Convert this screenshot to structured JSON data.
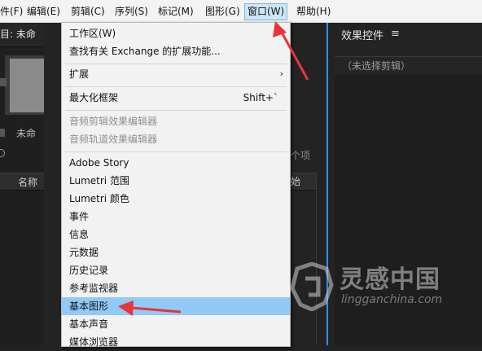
{
  "menubar": {
    "items": [
      {
        "label": "件(F)"
      },
      {
        "label": "编辑(E)"
      },
      {
        "label": "剪辑(C)"
      },
      {
        "label": "序列(S)"
      },
      {
        "label": "标记(M)"
      },
      {
        "label": "图形(G)"
      },
      {
        "label": "窗口(W)",
        "active": true
      },
      {
        "label": "帮助(H)"
      }
    ]
  },
  "left_panel": {
    "header": "目: 未命",
    "name_text": "未命",
    "column_name": "名称"
  },
  "middle_strip": {
    "count_text": "个项",
    "column_start": "始"
  },
  "effect_controls": {
    "title": "效果控件",
    "menu_icon": "hamburger-icon",
    "no_clip": "（未选择剪辑）"
  },
  "window_menu": {
    "items": [
      {
        "label": "工作区(W)",
        "submenu": false
      },
      {
        "label": "查找有关 Exchange 的扩展功能...",
        "submenu": false
      },
      {
        "label": "扩展",
        "submenu": true
      },
      {
        "label": "最大化框架",
        "shortcut": "Shift+`"
      },
      {
        "label": "音频剪辑效果编辑器",
        "disabled": true
      },
      {
        "label": "音频轨道效果编辑器",
        "disabled": true
      },
      {
        "label": "Adobe Story"
      },
      {
        "label": "Lumetri 范围"
      },
      {
        "label": "Lumetri 颜色"
      },
      {
        "label": "事件"
      },
      {
        "label": "信息"
      },
      {
        "label": "元数据"
      },
      {
        "label": "历史记录"
      },
      {
        "label": "参考监视器"
      },
      {
        "label": "基本图形",
        "highlighted": true
      },
      {
        "label": "基本声音"
      },
      {
        "label": "媒体浏览器"
      }
    ]
  },
  "watermark": {
    "title": "灵感中国",
    "url": "lingganchina.com"
  },
  "colors": {
    "accent_blue": "#2d8ceb",
    "highlight": "#91c9f7",
    "arrow_red": "#e8343a"
  }
}
